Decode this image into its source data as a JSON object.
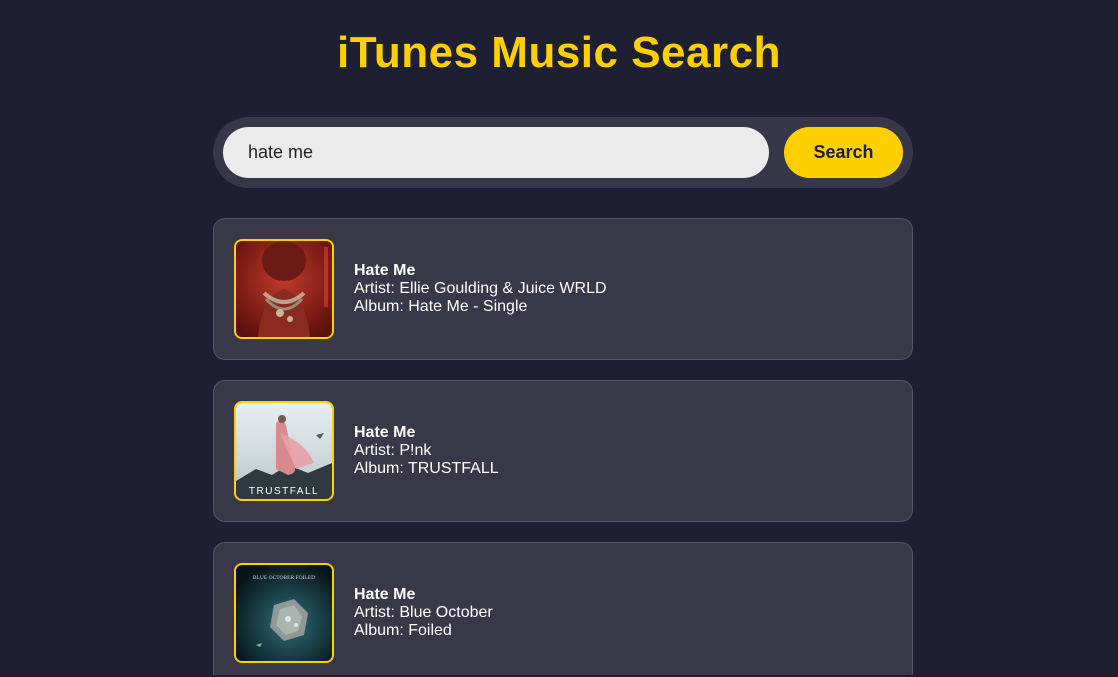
{
  "app": {
    "title": "iTunes Music Search"
  },
  "search": {
    "value": "hate me",
    "button_label": "Search"
  },
  "results": [
    {
      "track": "Hate Me",
      "artist": "Artist: Ellie Goulding & Juice WRLD",
      "album": "Album: Hate Me - Single",
      "cover_art": "red-portrait-cover"
    },
    {
      "track": "Hate Me",
      "artist": "Artist: P!nk",
      "album": "Album: TRUSTFALL",
      "cover_art": "trustfall-cover",
      "cover_text": "TRUSTFALL"
    },
    {
      "track": "Hate Me",
      "artist": "Artist: Blue October",
      "album": "Album: Foiled",
      "cover_art": "foiled-rock-cover",
      "cover_text": "BLUE OCTOBER FOILED"
    }
  ],
  "colors": {
    "accent": "#ffd000",
    "background": "#1f1f33",
    "card": "#383849"
  }
}
